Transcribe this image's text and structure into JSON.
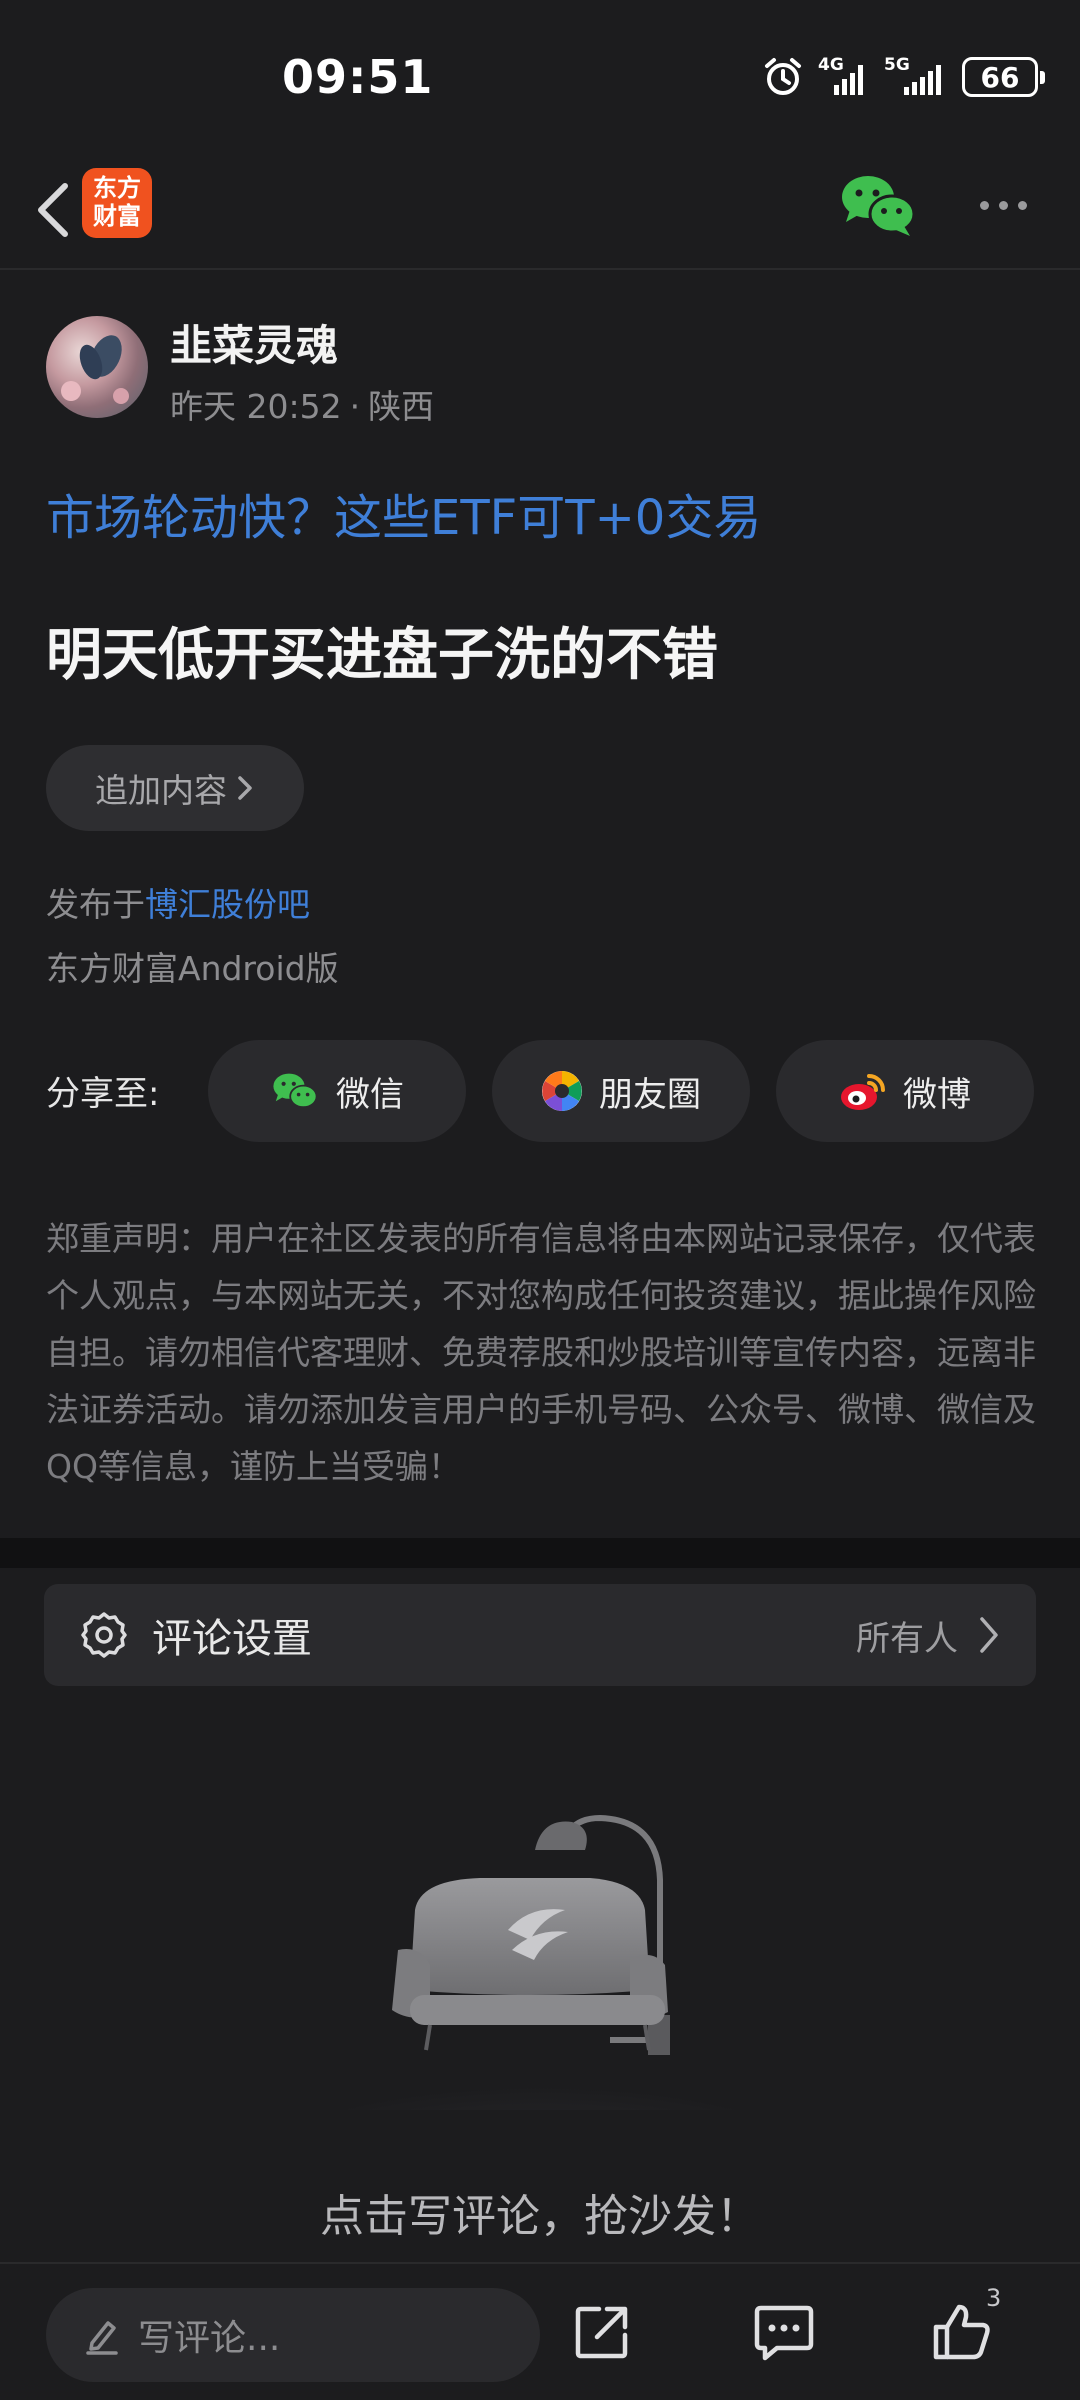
{
  "status_bar": {
    "time": "09:51",
    "network_1": "4G",
    "network_2": "5G",
    "battery": "66"
  },
  "nav": {
    "logo_line1": "东方",
    "logo_line2": "财富",
    "icons": [
      "back-icon",
      "wechat-icon",
      "more-icon"
    ]
  },
  "post": {
    "username": "韭菜灵魂",
    "time": "昨天 20:52",
    "location": "陕西",
    "ad_link": "市场轮动快？这些ETF可T+0交易",
    "body": "明天低开买进盘子洗的不错",
    "add_content_label": "追加内容",
    "posted_in_prefix": "发布于",
    "bar_name": "博汇股份吧",
    "client": "东方财富Android版"
  },
  "share": {
    "label": "分享至:",
    "targets": [
      {
        "label": "微信",
        "icon": "wechat-icon"
      },
      {
        "label": "朋友圈",
        "icon": "moments-icon"
      },
      {
        "label": "微博",
        "icon": "weibo-icon"
      }
    ]
  },
  "disclaimer": "郑重声明：用户在社区发表的所有信息将由本网站记录保存，仅代表个人观点，与本网站无关，不对您构成任何投资建议，据此操作风险自担。请勿相信代客理财、免费荐股和炒股培训等宣传内容，远离非法证券活动。请勿添加发言用户的手机号码、公众号、微博、微信及QQ等信息，谨防上当受骗！",
  "comment_settings": {
    "label": "评论设置",
    "value": "所有人"
  },
  "empty_state": {
    "text": "点击写评论，抢沙发！"
  },
  "bottom_bar": {
    "input_placeholder": "写评论...",
    "like_count": "3"
  },
  "colors": {
    "background": "#1c1c1e",
    "link_blue": "#3f7fd8",
    "brand_orange": "#f0521f",
    "wechat_green": "#3fbe4f"
  }
}
